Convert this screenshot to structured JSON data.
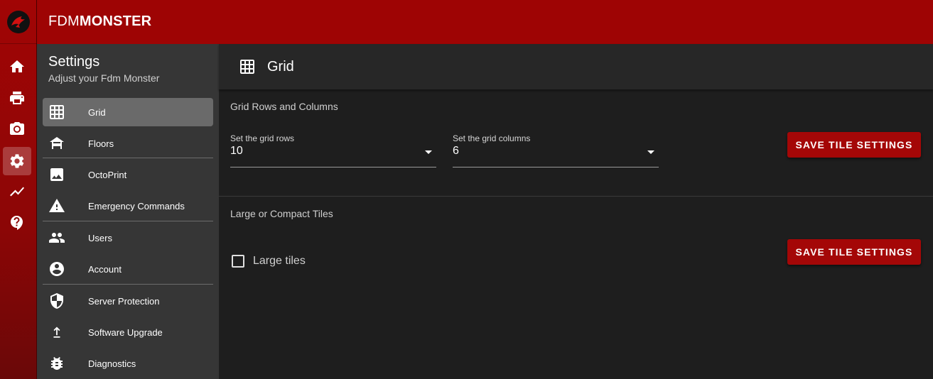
{
  "app": {
    "brand_prefix": "FDM",
    "brand_suffix": "MONSTER",
    "logo_icon": "dragon-logo-icon"
  },
  "rail": {
    "items": [
      {
        "name": "home",
        "icon": "home-icon",
        "active": false
      },
      {
        "name": "printers",
        "icon": "printer-icon",
        "active": false
      },
      {
        "name": "cameras",
        "icon": "camera-icon",
        "active": false
      },
      {
        "name": "settings",
        "icon": "gear-icon",
        "active": true
      },
      {
        "name": "statistics",
        "icon": "trending-icon",
        "active": false
      },
      {
        "name": "help",
        "icon": "help-icon",
        "active": false
      }
    ]
  },
  "settings_nav": {
    "title": "Settings",
    "subtitle": "Adjust your Fdm Monster",
    "items": [
      {
        "label": "Grid",
        "icon": "grid-icon",
        "active": true
      },
      {
        "label": "Floors",
        "icon": "floor-icon",
        "active": false
      },
      {
        "label": "OctoPrint",
        "icon": "image-icon",
        "active": false
      },
      {
        "label": "Emergency Commands",
        "icon": "warning-icon",
        "active": false
      },
      {
        "label": "Users",
        "icon": "users-icon",
        "active": false
      },
      {
        "label": "Account",
        "icon": "account-icon",
        "active": false
      },
      {
        "label": "Server Protection",
        "icon": "shield-icon",
        "active": false
      },
      {
        "label": "Software Upgrade",
        "icon": "upload-icon",
        "active": false
      },
      {
        "label": "Diagnostics",
        "icon": "bug-icon",
        "active": false
      }
    ]
  },
  "main": {
    "header_icon": "grid-icon",
    "header_title": "Grid",
    "rows_columns_section": {
      "title": "Grid Rows and Columns",
      "rows_label": "Set the grid rows",
      "rows_value": "10",
      "columns_label": "Set the grid columns",
      "columns_value": "6",
      "save_label": "SAVE TILE SETTINGS"
    },
    "tiles_section": {
      "title": "Large or Compact Tiles",
      "checkbox_label": "Large tiles",
      "checkbox_checked": false,
      "save_label": "SAVE TILE SETTINGS"
    }
  },
  "colors": {
    "brand_red": "#9e0404",
    "button_red": "#a40707",
    "panel_bg": "#363636",
    "main_bg": "#1e1e1e"
  }
}
